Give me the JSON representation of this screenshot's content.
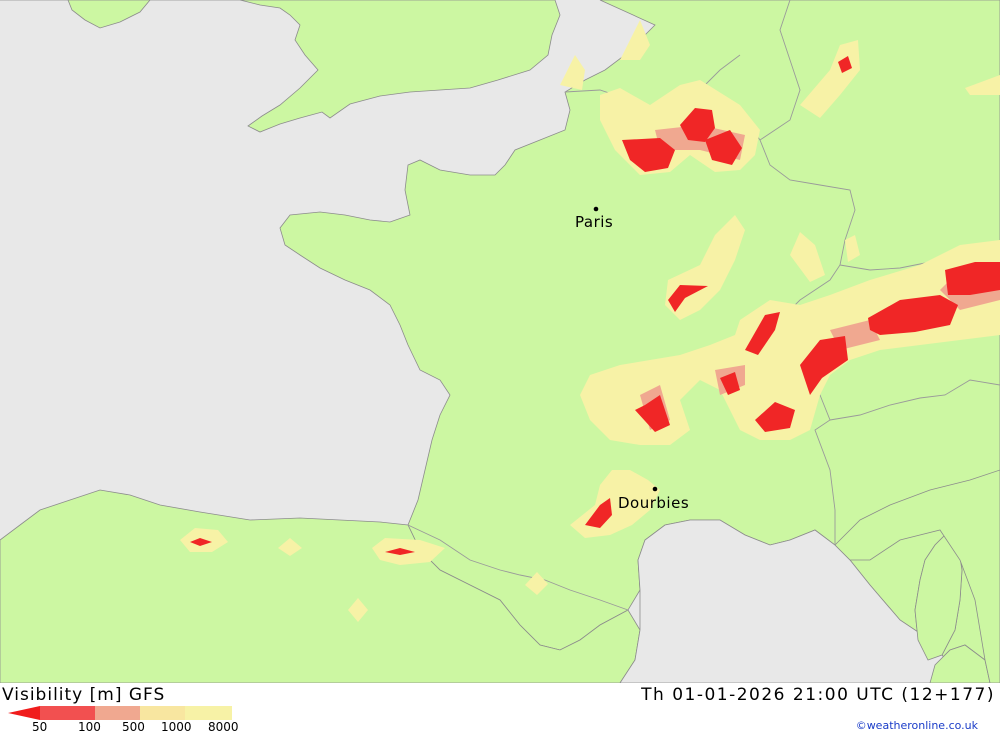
{
  "map": {
    "colors": {
      "sea": "#e8e8e8",
      "land": "#ccf7a2",
      "vis_8000": "#f7f2a6",
      "vis_1000": "#f8e6a0",
      "vis_500": "#f0a890",
      "vis_100": "#f25050",
      "vis_50": "#f01c1c",
      "border": "#9a9a9a",
      "coast": "#8c8c8c"
    },
    "cities": [
      {
        "name": "Paris"
      },
      {
        "name": "Dourbies"
      }
    ]
  },
  "footer": {
    "title": "Visibility [m] GFS",
    "datetime": "Th 01-01-2026 21:00 UTC (12+177)",
    "legend": {
      "ticks": [
        "50",
        "100",
        "500",
        "1000",
        "8000"
      ],
      "colors": [
        "#f01c1c",
        "#f25050",
        "#f0a890",
        "#f8e6a0",
        "#f7f2a6"
      ]
    },
    "credit": "©weatheronline.co.uk"
  }
}
